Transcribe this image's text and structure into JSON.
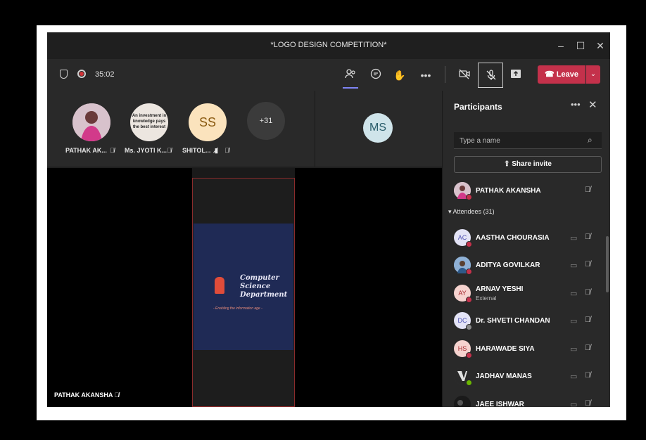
{
  "window": {
    "title": "*LOGO DESIGN COMPETITION*"
  },
  "toolbar": {
    "timer": "35:02",
    "leave_label": "Leave"
  },
  "gallery": {
    "tiles": [
      {
        "name": "PATHAK AK...",
        "avatar": "photo"
      },
      {
        "name": "Ms. JYOTI K...",
        "avatar_text_1": "An investment in",
        "avatar_text_2": "knowledge pays",
        "avatar_text_3": "the best interest"
      },
      {
        "name": "SHITOL...",
        "initials": "SS"
      },
      {
        "overflow": "+31"
      }
    ],
    "ms_tile": {
      "initials": "MS"
    }
  },
  "stage": {
    "presenter": "PATHAK AKANSHA",
    "slide_line1": "Computer",
    "slide_line2": "Science",
    "slide_line3": "Department",
    "slide_tagline": "- Enabling the information age -"
  },
  "participants": {
    "title": "Participants",
    "search_placeholder": "Type a name",
    "share_invite": "Share invite",
    "organizer": {
      "name": "PATHAK AKANSHA"
    },
    "attendees_label": "Attendees (31)",
    "attendees": [
      {
        "initials": "AC",
        "name": "AASTHA CHOURASIA",
        "bg": "#e3e3f6",
        "fg": "#4f52b2"
      },
      {
        "initials": "",
        "name": "ADITYA GOVILKAR",
        "bg": "#6d8fb5",
        "fg": "#fff"
      },
      {
        "initials": "AY",
        "name": "ARNAV YESHI",
        "sub": "External",
        "bg": "#f6d3cf",
        "fg": "#a4262c"
      },
      {
        "initials": "DC",
        "name": "Dr. SHVETI CHANDAN",
        "bg": "#e3e3f6",
        "fg": "#4f52b2"
      },
      {
        "initials": "HS",
        "name": "HARAWADE SIYA",
        "bg": "#f6d3cf",
        "fg": "#a4262c"
      },
      {
        "initials": "",
        "name": "JADHAV MANAS",
        "bg": "#3a3a3a",
        "fg": "#fff"
      },
      {
        "initials": "",
        "name": "JAEE ISHWAR",
        "bg": "#222",
        "fg": "#fff"
      }
    ]
  },
  "colors": {
    "leave": "#c4314b",
    "accent": "#7f85f5",
    "panel": "#292929"
  }
}
